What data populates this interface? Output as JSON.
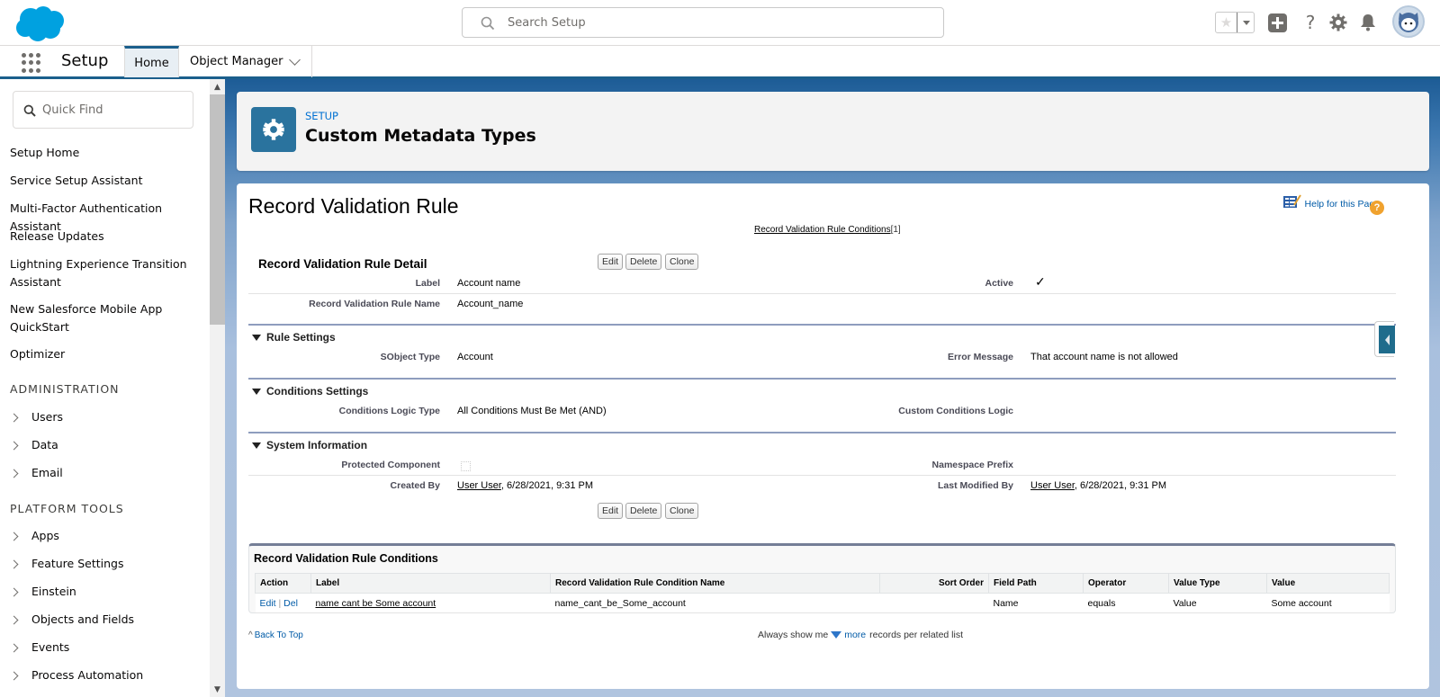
{
  "global_header": {
    "logo": "salesforce-cloud-logo",
    "search_placeholder": "Search Setup",
    "icons": [
      "star-icon",
      "chevron-down-icon",
      "plus-icon",
      "help-icon",
      "gear-icon",
      "bell-icon",
      "avatar"
    ]
  },
  "context_bar": {
    "app_name": "Setup",
    "tabs": [
      {
        "label": "Home",
        "active": true
      },
      {
        "label": "Object Manager",
        "active": false
      }
    ]
  },
  "sidebar": {
    "quick_find_placeholder": "Quick Find",
    "items": [
      "Setup Home",
      "Service Setup Assistant",
      "Multi-Factor Authentication Assistant",
      "Release Updates",
      "Lightning Experience Transition Assistant",
      "New Salesforce Mobile App QuickStart",
      "Optimizer"
    ],
    "sections": [
      {
        "title": "ADMINISTRATION",
        "items": [
          "Users",
          "Data",
          "Email"
        ]
      },
      {
        "title": "PLATFORM TOOLS",
        "items": [
          "Apps",
          "Feature Settings",
          "Einstein",
          "Objects and Fields",
          "Events",
          "Process Automation"
        ]
      }
    ]
  },
  "page_header": {
    "eyebrow": "SETUP",
    "title": "Custom Metadata Types"
  },
  "record": {
    "title": "Record Validation Rule",
    "help_link": "Help for this Page",
    "related_link": "Record Validation Rule Conditions",
    "related_count": "[1]",
    "detail_title": "Record Validation Rule Detail",
    "buttons": {
      "edit": "Edit",
      "delete": "Delete",
      "clone": "Clone"
    },
    "fields": {
      "label": {
        "label": "Label",
        "value": "Account name"
      },
      "active": {
        "label": "Active",
        "value": "✓",
        "checked": true
      },
      "name": {
        "label": "Record Validation Rule Name",
        "value": "Account_name"
      }
    },
    "rule_settings": {
      "title": "Rule Settings",
      "sobject_type": {
        "label": "SObject Type",
        "value": "Account"
      },
      "error_message": {
        "label": "Error Message",
        "value": "That account name is not allowed"
      }
    },
    "conditions_settings": {
      "title": "Conditions Settings",
      "logic_type": {
        "label": "Conditions Logic Type",
        "value": "All Conditions Must Be Met (AND)"
      },
      "custom_logic": {
        "label": "Custom Conditions Logic",
        "value": ""
      }
    },
    "system_information": {
      "title": "System Information",
      "protected": {
        "label": "Protected Component",
        "checked": false
      },
      "namespace": {
        "label": "Namespace Prefix",
        "value": ""
      },
      "created_by": {
        "label": "Created By",
        "user": "User User",
        "date": ", 6/28/2021, 9:31 PM"
      },
      "modified_by": {
        "label": "Last Modified By",
        "user": "User User",
        "date": ", 6/28/2021, 9:31 PM"
      }
    }
  },
  "related_list": {
    "title": "Record Validation Rule Conditions",
    "columns": [
      "Action",
      "Label",
      "Record Validation Rule Condition Name",
      "Sort Order",
      "Field Path",
      "Operator",
      "Value Type",
      "Value"
    ],
    "rows": [
      {
        "action_edit": "Edit",
        "action_sep": "|",
        "action_del": "Del",
        "label": "name cant be Some account",
        "name": "name_cant_be_Some_account",
        "sort_order": "",
        "field_path": "Name",
        "operator": "equals",
        "value_type": "Value",
        "value": "Some account"
      }
    ]
  },
  "footer": {
    "back_to_top": "Back To Top",
    "always_show": "Always show me",
    "more": "more",
    "records_per": "records per related list"
  }
}
